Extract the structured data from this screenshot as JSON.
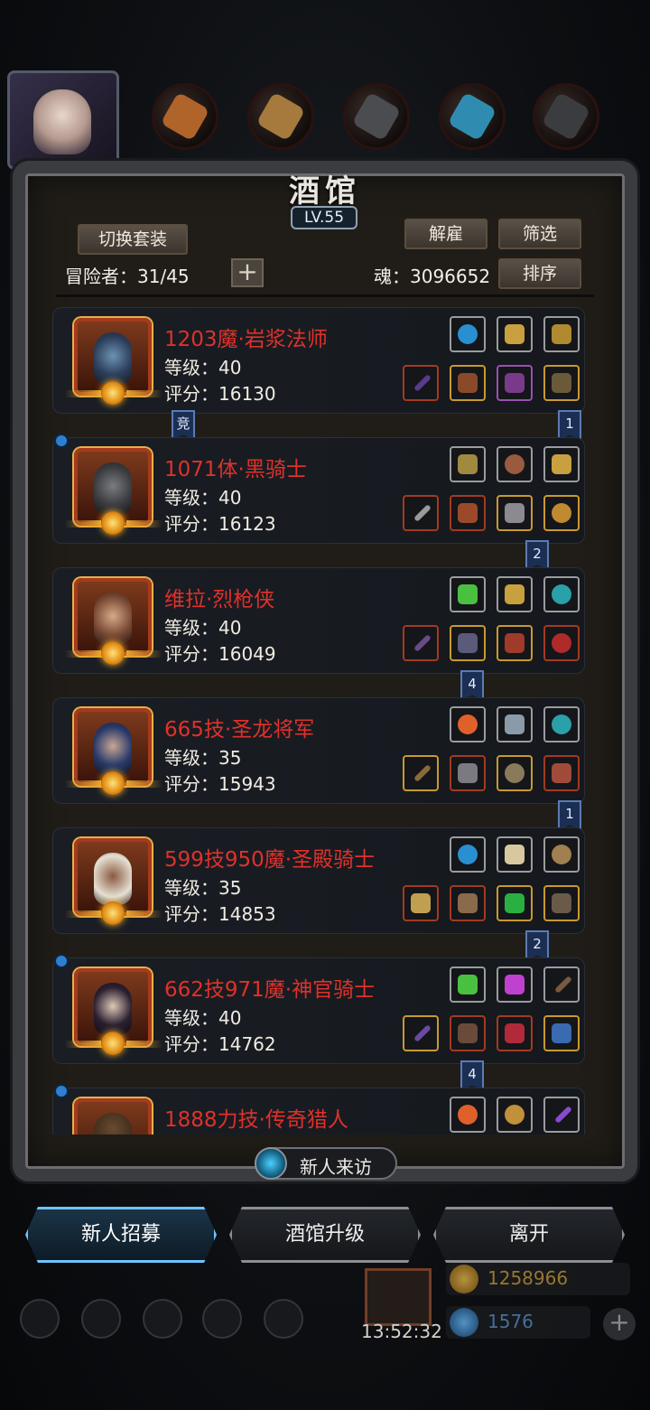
{
  "header": {
    "title": "酒馆",
    "level": "LV.55",
    "switch_outfit": "切换套装",
    "dismiss": "解雇",
    "filter": "筛选",
    "sort": "排序",
    "adventurers": "冒险者：31/45",
    "soul": "魂：3096652"
  },
  "heroes": [
    {
      "name": "1203魔·岩浆法师",
      "level": "等级：40",
      "score": "评分：16130",
      "dot": false,
      "ribbon": "竞"
    },
    {
      "name": "1071体·黑骑士",
      "level": "等级：40",
      "score": "评分：16123",
      "dot": true,
      "ribbon": "2"
    },
    {
      "name": "维拉·烈枪侠",
      "level": "等级：40",
      "score": "评分：16049",
      "dot": false,
      "ribbon": "4"
    },
    {
      "name": "665技·圣龙将军",
      "level": "等级：35",
      "score": "评分：15943",
      "dot": false,
      "ribbon": "1"
    },
    {
      "name": "599技950魔·圣殿骑士",
      "level": "等级：35",
      "score": "评分：14853",
      "dot": false,
      "ribbon": "2"
    },
    {
      "name": "662技971魔·神官骑士",
      "level": "等级：40",
      "score": "评分：14762",
      "dot": true,
      "ribbon": "4"
    },
    {
      "name": "1888力技·传奇猎人",
      "level": "",
      "score": "",
      "dot": true,
      "ribbon": ""
    }
  ],
  "ribbon_extra": {
    "card0_right": "1"
  },
  "bottom": {
    "visitor": "新人来访",
    "recruit": "新人招募",
    "upgrade": "酒馆升级",
    "leave": "离开",
    "timer": "13:52:32",
    "gold": "1258966",
    "gems": "1576"
  },
  "colors": {
    "accent_blue": "#6fc4ff",
    "name_red": "#e0312a",
    "frame": "#3a3c40"
  }
}
